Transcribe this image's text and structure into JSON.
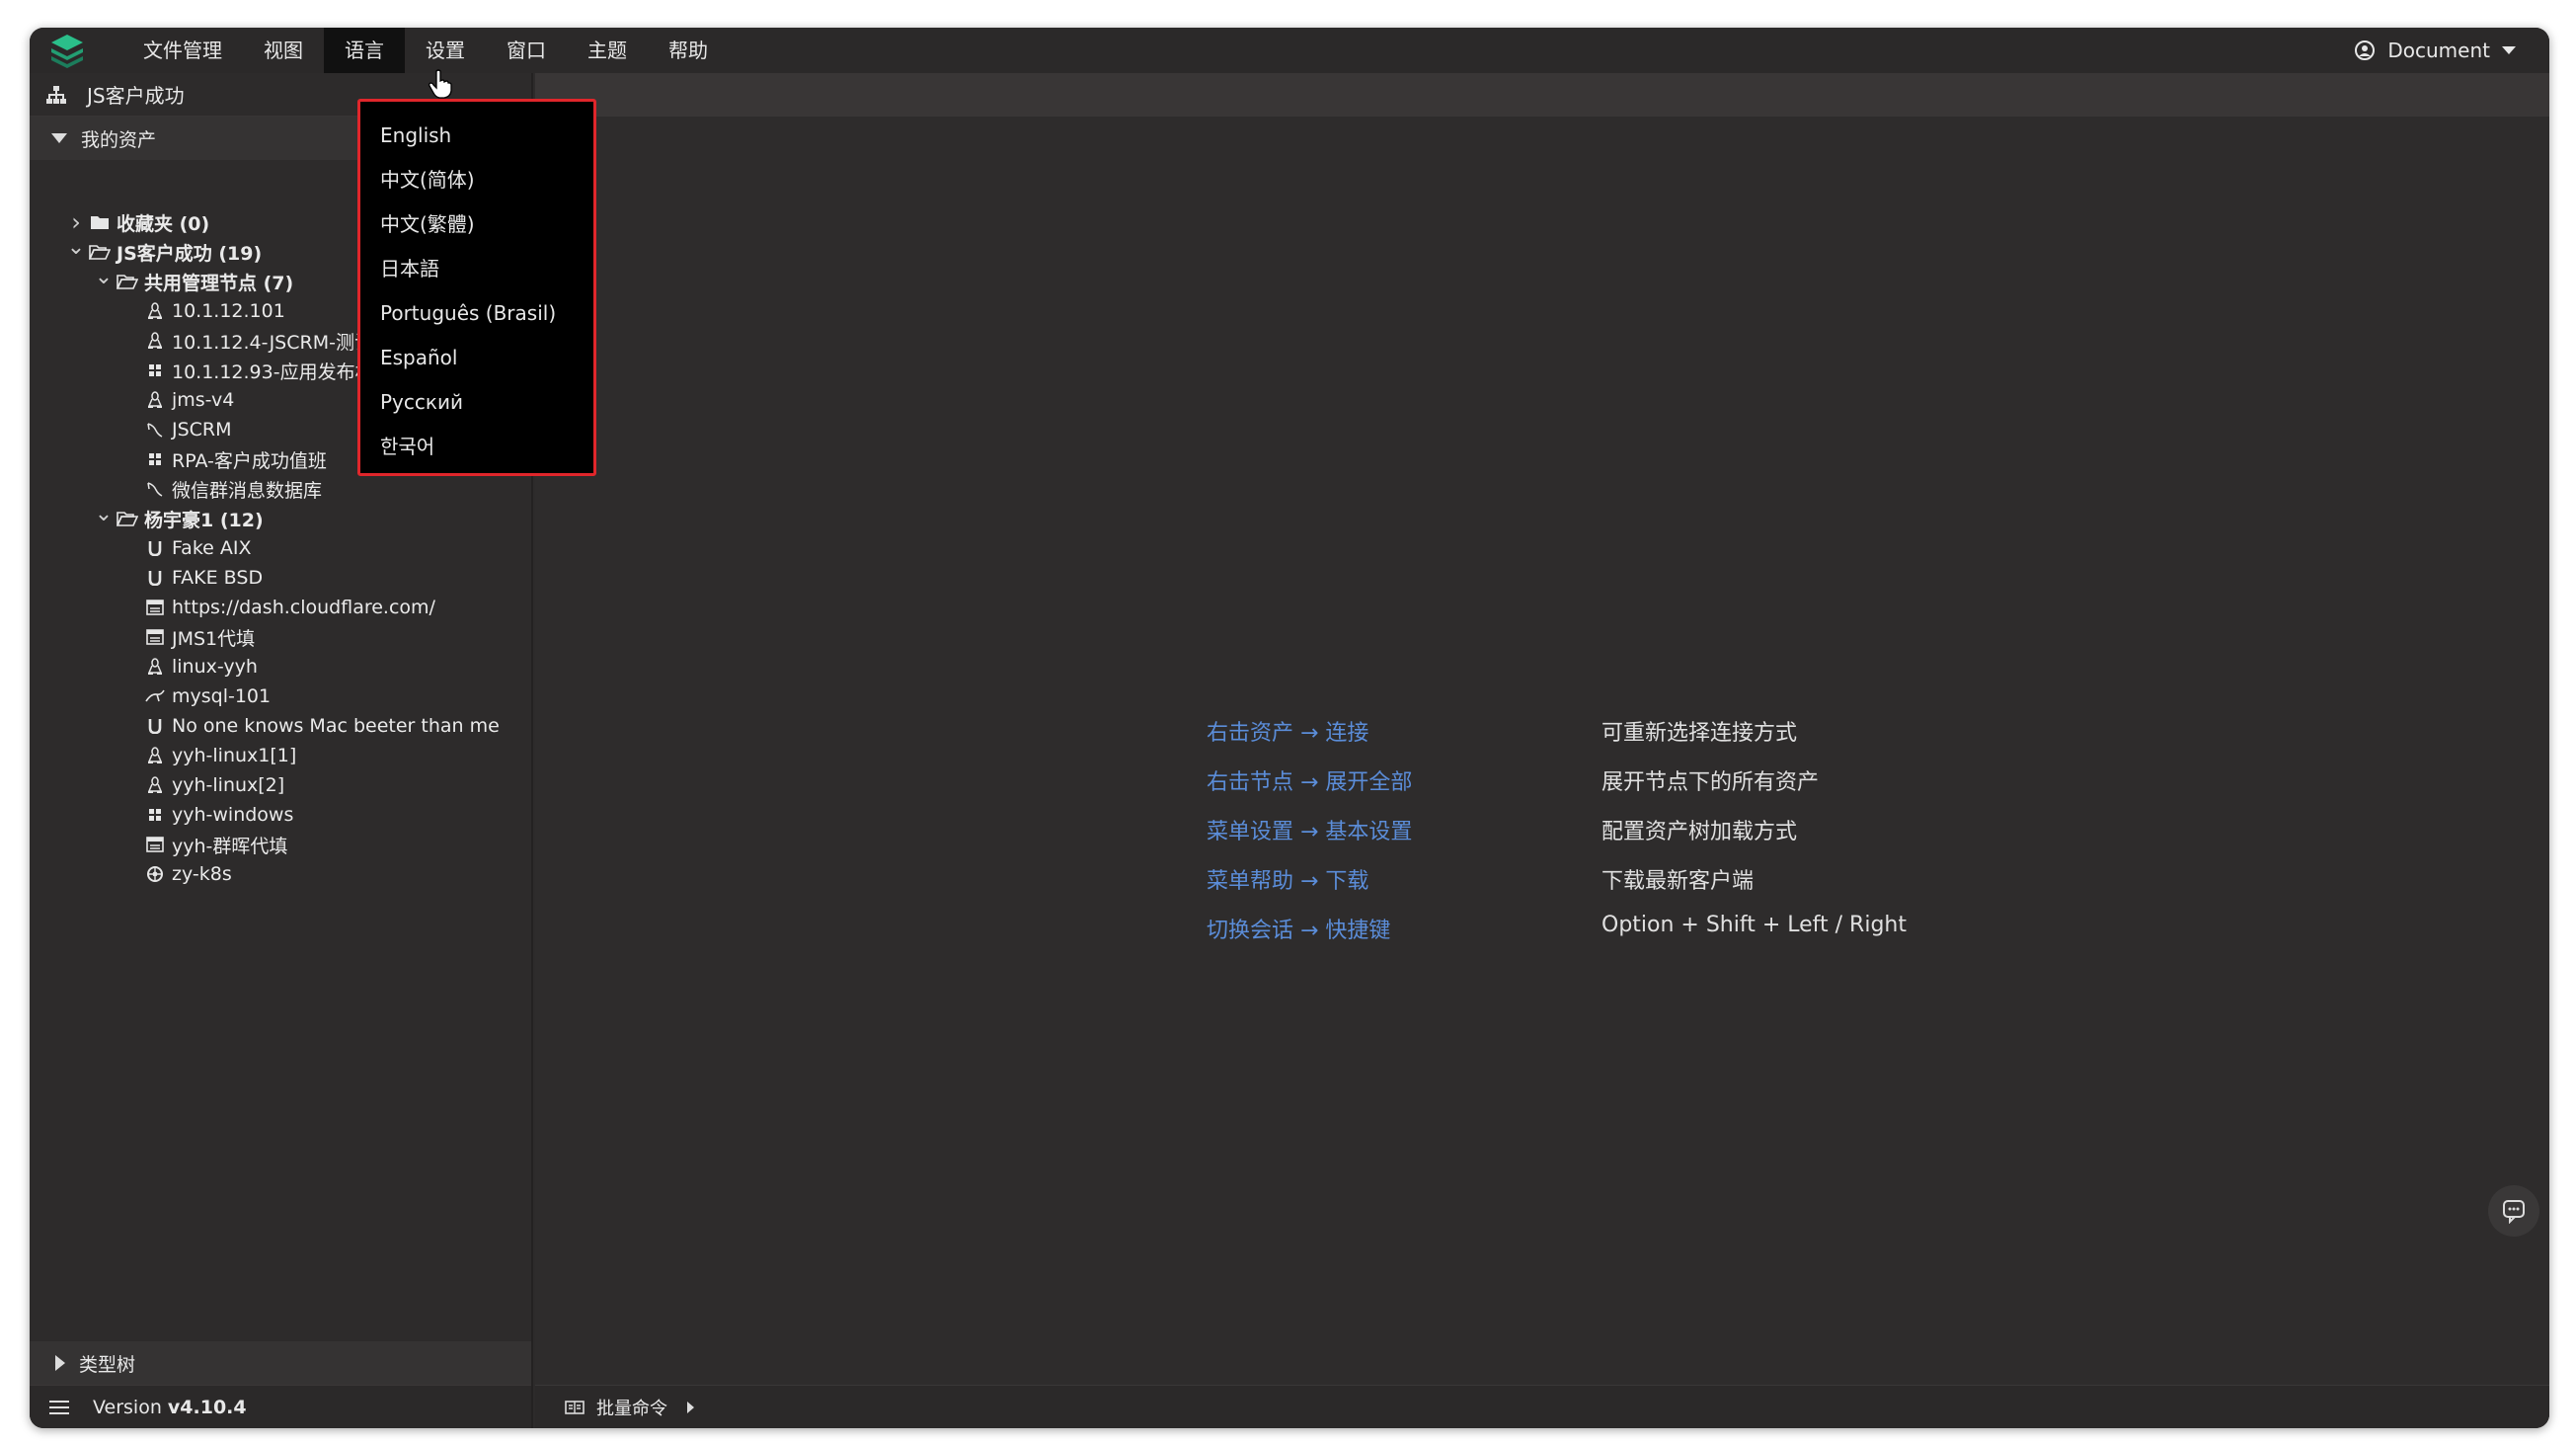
{
  "menubar": {
    "items": [
      "文件管理",
      "视图",
      "语言",
      "设置",
      "窗口",
      "主题",
      "帮助"
    ],
    "active_index": 2,
    "user": "Document"
  },
  "language_menu": {
    "options": [
      "English",
      "中文(简体)",
      "中文(繁體)",
      "日本語",
      "Português (Brasil)",
      "Español",
      "Русский",
      "한국어"
    ]
  },
  "sidebar": {
    "org": "JS客户成功",
    "my_assets": "我的资产",
    "tree": [
      {
        "level": 0,
        "chevron": "right",
        "icon": "folder",
        "label": "收藏夹 (0)",
        "bold": true
      },
      {
        "level": 0,
        "chevron": "down",
        "icon": "folder-open",
        "label": "JS客户成功 (19)",
        "bold": true
      },
      {
        "level": 1,
        "chevron": "down",
        "icon": "folder-open",
        "label": "共用管理节点 (7)",
        "bold": true
      },
      {
        "level": 2,
        "icon": "linux",
        "label": "10.1.12.101"
      },
      {
        "level": 2,
        "icon": "linux",
        "label": "10.1.12.4-JSCRM-测试"
      },
      {
        "level": 2,
        "icon": "windows",
        "label": "10.1.12.93-应用发布机"
      },
      {
        "level": 2,
        "icon": "linux",
        "label": "jms-v4"
      },
      {
        "level": 2,
        "icon": "database",
        "label": "JSCRM"
      },
      {
        "level": 2,
        "icon": "windows",
        "label": "RPA-客户成功值班"
      },
      {
        "level": 2,
        "icon": "database",
        "label": "微信群消息数据库"
      },
      {
        "level": 1,
        "chevron": "down",
        "icon": "folder-open",
        "label": "杨宇豪1 (12)",
        "bold": true
      },
      {
        "level": 2,
        "icon": "unix",
        "label": "Fake AIX"
      },
      {
        "level": 2,
        "icon": "unix",
        "label": "FAKE BSD"
      },
      {
        "level": 2,
        "icon": "web",
        "label": "https://dash.cloudflare.com/"
      },
      {
        "level": 2,
        "icon": "web",
        "label": "JMS1代填"
      },
      {
        "level": 2,
        "icon": "linux",
        "label": "linux-yyh"
      },
      {
        "level": 2,
        "icon": "mysql",
        "label": "mysql-101"
      },
      {
        "level": 2,
        "icon": "unix",
        "label": "No one knows Mac beeter than me"
      },
      {
        "level": 2,
        "icon": "linux",
        "label": "yyh-linux1[1]"
      },
      {
        "level": 2,
        "icon": "linux",
        "label": "yyh-linux[2]"
      },
      {
        "level": 2,
        "icon": "windows",
        "label": "yyh-windows"
      },
      {
        "level": 2,
        "icon": "web",
        "label": "yyh-群晖代填"
      },
      {
        "level": 2,
        "icon": "k8s",
        "label": "zy-k8s"
      }
    ],
    "type_tree": "类型树",
    "version_label": "Version",
    "version": "v4.10.4"
  },
  "main": {
    "hints": [
      {
        "left": "右击资产 → 连接",
        "right": "可重新选择连接方式"
      },
      {
        "left": "右击节点 → 展开全部",
        "right": "展开节点下的所有资产"
      },
      {
        "left": "菜单设置 → 基本设置",
        "right": "配置资产树加载方式"
      },
      {
        "left": "菜单帮助 → 下载",
        "right": "下载最新客户端"
      },
      {
        "left": "切换会话 → 快捷键",
        "right": "Option + Shift + Left / Right"
      }
    ],
    "batch_command": "批量命令"
  },
  "colors": {
    "window_bg": "#2d2b2b",
    "hint_link": "#5b8dd9",
    "dropdown_border": "#e0262b",
    "logo_green": "#2bbf8a"
  }
}
